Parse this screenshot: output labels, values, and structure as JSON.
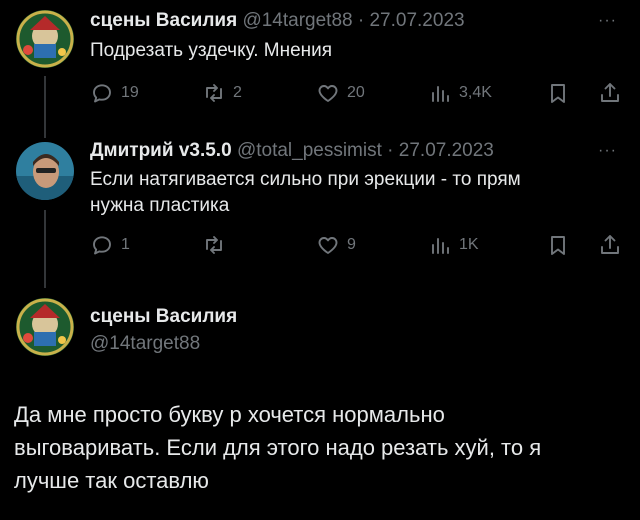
{
  "tweets": [
    {
      "author": "сцены Василия",
      "handle": "@14target88",
      "separator": "·",
      "date": "27.07.2023",
      "text": "Подрезать уздечку. Мнения",
      "stats": {
        "replies": "19",
        "retweets": "2",
        "likes": "20",
        "views": "3,4K"
      }
    },
    {
      "author": "Дмитрий v3.5.0",
      "handle": "@total_pessimist",
      "separator": "·",
      "date": "27.07.2023",
      "text_lines": [
        "Если натягивается сильно при эрекции - то прям",
        "нужна пластика"
      ],
      "stats": {
        "replies": "1",
        "retweets": "",
        "likes": "9",
        "views": "1K"
      }
    }
  ],
  "main_tweet": {
    "author": "сцены Василия",
    "handle": "@14target88",
    "text_lines": [
      "Да мне просто букву р хочется нормально",
      "выговаривать. Если для этого надо резать хуй, то я",
      "лучше так оставлю"
    ]
  },
  "more_label": "···",
  "colors": {
    "background": "#000000",
    "text": "#e7e9ea",
    "muted": "#71767b",
    "thread_line": "#333639"
  },
  "icons": [
    "reply-icon",
    "retweet-icon",
    "like-icon",
    "views-icon",
    "bookmark-icon",
    "share-icon"
  ]
}
